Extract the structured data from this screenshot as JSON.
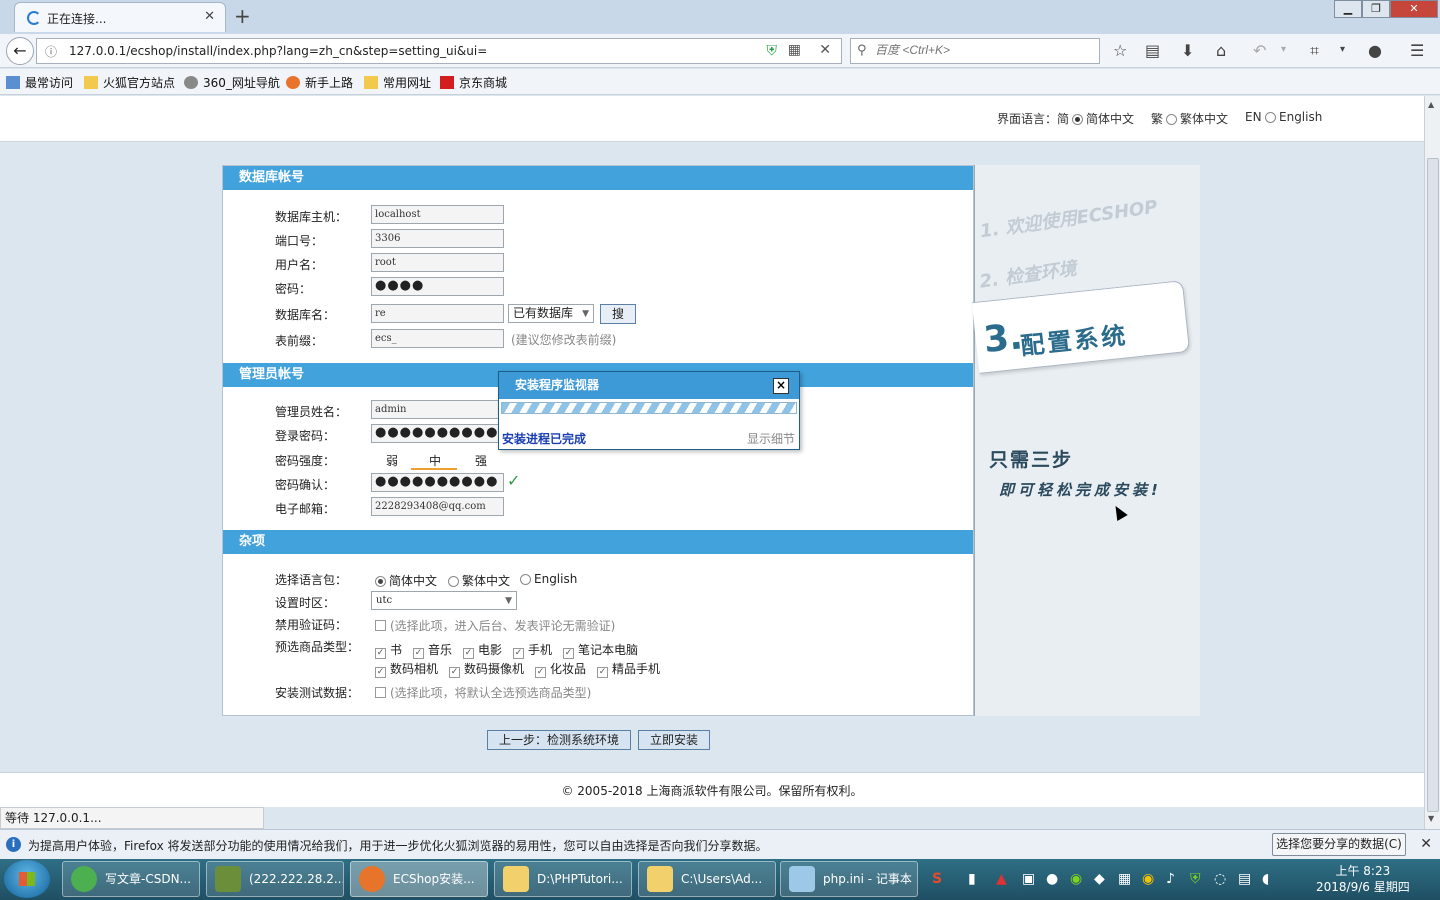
{
  "browser": {
    "tab_title": "正在连接...",
    "url": "127.0.0.1/ecshop/install/index.php?lang=zh_cn&step=setting_ui&ui=",
    "search_placeholder": "百度 <Ctrl+K>",
    "bookmarks": [
      "最常访问",
      "火狐官方站点",
      "360_网址导航",
      "新手上路",
      "常用网址",
      "京东商城"
    ],
    "status": "等待 127.0.0.1...",
    "notification": "为提高用户体验，Firefox 将发送部分功能的使用情况给我们，用于进一步优化火狐浏览器的易用性，您可以自由选择是否向我们分享数据。",
    "notification_button": "选择您要分享的数据(C)"
  },
  "lang_bar": {
    "label": "界面语言：简",
    "options": [
      "简体中文",
      "繁",
      "繁体中文",
      "EN",
      "English"
    ]
  },
  "db_section": {
    "title": "数据库帐号",
    "host_label": "数据库主机：",
    "host": "localhost",
    "port_label": "端口号：",
    "port": "3306",
    "user_label": "用户名：",
    "user": "root",
    "pass_label": "密码：",
    "pass": "●●●●",
    "dbname_label": "数据库名：",
    "dbname": "re",
    "db_select": "已有数据库",
    "search_btn": "搜",
    "prefix_label": "表前缀：",
    "prefix": "ecs_",
    "prefix_hint": "(建议您修改表前缀)"
  },
  "admin_section": {
    "title": "管理员帐号",
    "name_label": "管理员姓名：",
    "name": "admin",
    "pass_label": "登录密码：",
    "pass": "●●●●●●●●●●",
    "strength_label": "密码强度：",
    "weak": "弱",
    "medium": "中",
    "strong": "强",
    "confirm_label": "密码确认：",
    "confirm": "●●●●●●●●●●",
    "email_label": "电子邮箱：",
    "email": "2228293408@qq.com"
  },
  "misc_section": {
    "title": "杂项",
    "lang_label": "选择语言包：",
    "lang_opts": [
      "简体中文",
      "繁体中文",
      "English"
    ],
    "tz_label": "设置时区：",
    "tz": "utc",
    "captcha_label": "禁用验证码：",
    "captcha_hint": "(选择此项，进入后台、发表评论无需验证)",
    "types_label": "预选商品类型：",
    "types_row1": [
      "书",
      "音乐",
      "电影",
      "手机",
      "笔记本电脑"
    ],
    "types_row2": [
      "数码相机",
      "数码摄像机",
      "化妆品",
      "精品手机"
    ],
    "testdata_label": "安装测试数据：",
    "testdata_hint": "(选择此项，将默认全选预选商品类型)"
  },
  "steps": {
    "step1": "1. 欢迎使用ECSHOP",
    "step2": "2. 检查环境",
    "step3_num": "3.",
    "step3_text": "配置系统",
    "slogan1": "只需三步",
    "slogan2": "即可轻松完成安装!"
  },
  "monitor": {
    "title": "安装程序监视器",
    "close": "×",
    "done": "安装进程已完成",
    "detail": "显示细节"
  },
  "buttons": {
    "prev": "上一步：检测系统环境",
    "install": "立即安装"
  },
  "footer": "© 2005-2018 上海商派软件有限公司。保留所有权利。",
  "taskbar": {
    "tasks": [
      "写文章-CSDN...",
      "(222.222.28.2...",
      "ECShop安装...",
      "D:\\PHPTutori...",
      "C:\\Users\\Ad...",
      "php.ini - 记事本"
    ],
    "time": "上午 8:23",
    "date": "2018/9/6 星期四"
  },
  "colors": {
    "section_blue": "#41a2dc",
    "accent_text": "#2b6c8c"
  }
}
